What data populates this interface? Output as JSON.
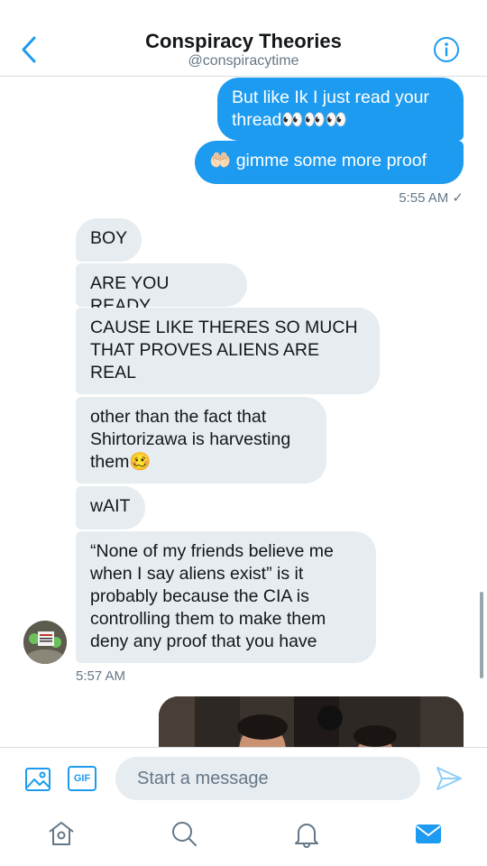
{
  "header": {
    "title": "Conspiracy Theories",
    "handle": "@conspiracytime"
  },
  "messages": {
    "out1": "But like Ik I just read your thread👀👀👀",
    "out2": "🤲🏻 gimme some more proof",
    "out_time": "5:55 AM ✓",
    "in1": "BOY",
    "in2": "ARE YOU READY",
    "in3": "CAUSE LIKE THERES SO MUCH THAT PROVES ALIENS ARE REAL",
    "in4": "other than the fact that Shirtorizawa is harvesting them🥴",
    "in5": "wAIT",
    "in6": "“None of my friends believe me when I say aliens exist” is it probably because the CIA is controlling them to make them deny any proof that you have",
    "in_time": "5:57 AM",
    "avatar_text": "AREA 51"
  },
  "composer": {
    "placeholder": "Start a message",
    "gif_label": "GIF"
  },
  "colors": {
    "accent": "#1d9bf0",
    "incoming_bubble": "#e6ecf0",
    "secondary_text": "#657786"
  },
  "icons": [
    "back-arrow-icon",
    "info-icon",
    "image-icon",
    "gif-icon",
    "send-icon",
    "home-icon",
    "search-icon",
    "bell-icon",
    "mail-icon"
  ]
}
